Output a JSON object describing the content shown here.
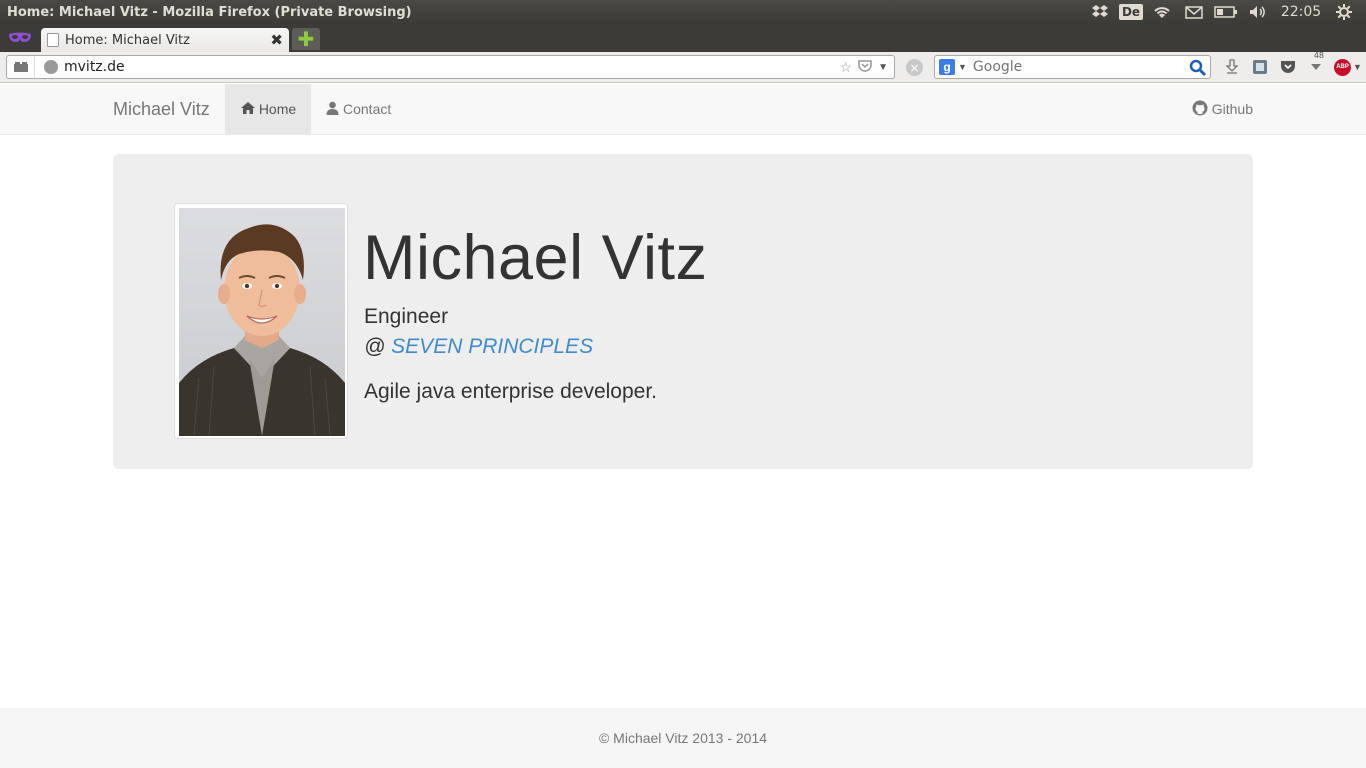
{
  "os": {
    "window_title": "Home: Michael Vitz - Mozilla Firefox (Private Browsing)",
    "keyboard_layout": "De",
    "clock": "22:05",
    "indicators": [
      "dropbox-icon",
      "keyboard-layout",
      "wifi-icon",
      "mail-icon",
      "battery-icon",
      "volume-icon",
      "clock",
      "gear-icon"
    ]
  },
  "browser": {
    "tab_title": "Home: Michael Vitz",
    "url": "mvitz.de",
    "search_placeholder": "Google",
    "downloads_count": "48"
  },
  "site": {
    "brand": "Michael Vitz",
    "nav": {
      "home": "Home",
      "contact": "Contact",
      "github": "Github",
      "active": "Home"
    },
    "hero": {
      "name": "Michael Vitz",
      "role": "Engineer",
      "at": "@",
      "company": "SEVEN PRINCIPLES",
      "tagline": "Agile java enterprise developer."
    },
    "footer": "© Michael Vitz 2013 - 2014"
  },
  "colors": {
    "link": "#428bca",
    "jumbotron_bg": "#eeeeee",
    "navbar_bg": "#f8f8f8",
    "os_panel": "#3c3b37"
  }
}
